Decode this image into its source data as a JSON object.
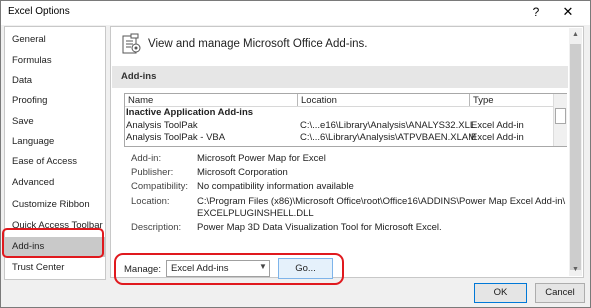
{
  "window": {
    "title": "Excel Options",
    "help_glyph": "?",
    "close_glyph": "✕"
  },
  "sidebar": {
    "items": [
      {
        "label": "General"
      },
      {
        "label": "Formulas"
      },
      {
        "label": "Data"
      },
      {
        "label": "Proofing"
      },
      {
        "label": "Save"
      },
      {
        "label": "Language"
      },
      {
        "label": "Ease of Access"
      },
      {
        "label": "Advanced"
      },
      {
        "label": "Customize Ribbon"
      },
      {
        "label": "Quick Access Toolbar"
      },
      {
        "label": "Add-ins",
        "selected": true
      },
      {
        "label": "Trust Center"
      }
    ]
  },
  "header": {
    "icon": "add-ins-icon",
    "text": "View and manage Microsoft Office Add-ins."
  },
  "section": {
    "title": "Add-ins"
  },
  "list": {
    "columns": [
      "Name",
      "Location",
      "Type"
    ],
    "group_title": "Inactive Application Add-ins",
    "rows": [
      {
        "name": "Analysis ToolPak",
        "location": "C:\\...e16\\Library\\Analysis\\ANALYS32.XLL",
        "type": "Excel Add-in"
      },
      {
        "name": "Analysis ToolPak - VBA",
        "location": "C:\\...6\\Library\\Analysis\\ATPVBAEN.XLAM",
        "type": "Excel Add-in"
      }
    ]
  },
  "details": {
    "addin_label": "Add-in:",
    "addin_value": "Microsoft Power Map for Excel",
    "publisher_label": "Publisher:",
    "publisher_value": "Microsoft Corporation",
    "compat_label": "Compatibility:",
    "compat_value": "No compatibility information available",
    "location_label": "Location:",
    "location_value_1": "C:\\Program Files (x86)\\Microsoft Office\\root\\Office16\\ADDINS\\Power Map Excel Add-in\\",
    "location_value_2": "EXCELPLUGINSHELL.DLL",
    "description_label": "Description:",
    "description_value": "Power Map 3D Data Visualization Tool for Microsoft Excel."
  },
  "manage": {
    "label": "Manage:",
    "selected": "Excel Add-ins",
    "go_label": "Go..."
  },
  "footer": {
    "ok_label": "OK",
    "cancel_label": "Cancel"
  },
  "colors": {
    "highlight": "#e0191e",
    "selected_nav": "#c9c9c9"
  }
}
